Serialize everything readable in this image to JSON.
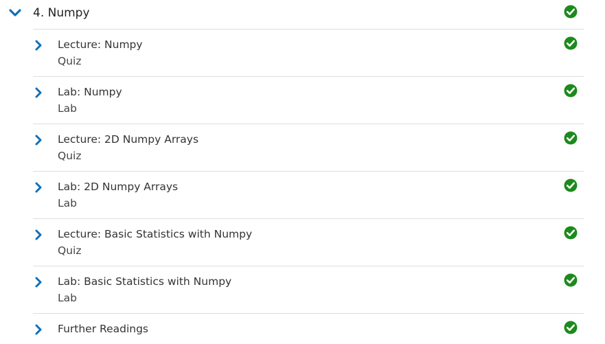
{
  "section": {
    "title": "4. Numpy",
    "expanded_icon": "chevron-down-icon",
    "status_icon": "check-circle-icon",
    "status_color": "#1c8a1c"
  },
  "accent_color": "#0f6fb8",
  "units": [
    {
      "title": "Lecture: Numpy",
      "type": "Quiz",
      "completed": true
    },
    {
      "title": "Lab: Numpy",
      "type": "Lab",
      "completed": true
    },
    {
      "title": "Lecture: 2D Numpy Arrays",
      "type": "Quiz",
      "completed": true
    },
    {
      "title": "Lab: 2D Numpy Arrays",
      "type": "Lab",
      "completed": true
    },
    {
      "title": "Lecture: Basic Statistics with Numpy",
      "type": "Quiz",
      "completed": true
    },
    {
      "title": "Lab: Basic Statistics with Numpy",
      "type": "Lab",
      "completed": true
    },
    {
      "title": "Further Readings",
      "type": "",
      "completed": true
    }
  ]
}
